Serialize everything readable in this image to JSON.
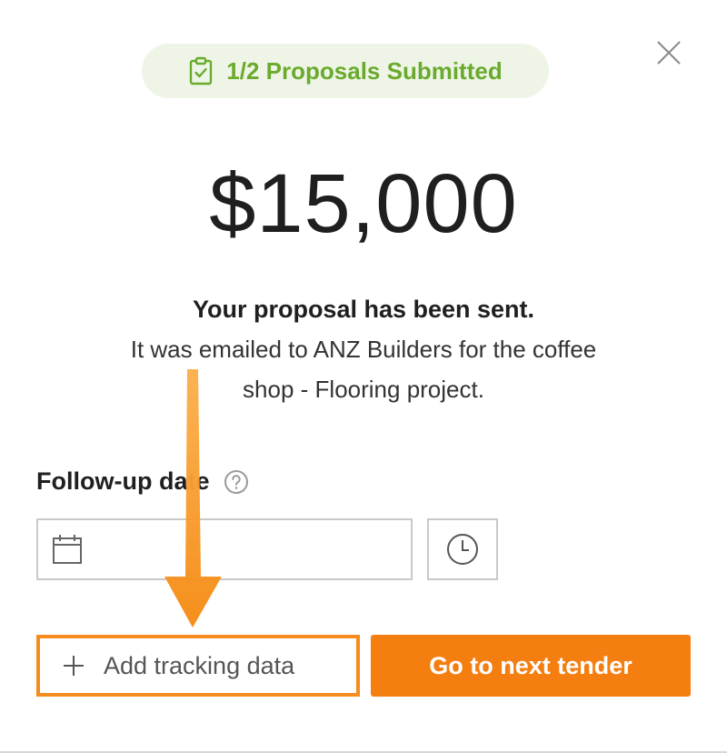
{
  "status_badge": {
    "text": "1/2 Proposals Submitted",
    "icon": "clipboard-check-icon",
    "color": "#6aaa2c",
    "background": "#eef5e7"
  },
  "close": {
    "icon": "close-icon"
  },
  "amount": "$15,000",
  "message": {
    "title": "Your proposal has been sent.",
    "line1": "It was emailed to ANZ Builders for the coffee",
    "line2": "shop - Flooring project."
  },
  "followup": {
    "label": "Follow-up date",
    "help_icon": "question-circle-icon",
    "date_value": "",
    "date_icon": "calendar-icon",
    "time_icon": "clock-icon"
  },
  "actions": {
    "tracking_label": "Add tracking data",
    "tracking_icon": "plus-icon",
    "next_label": "Go to next tender",
    "accent_color": "#f57e10"
  },
  "annotation": {
    "type": "arrow",
    "color": "#f7941d"
  }
}
